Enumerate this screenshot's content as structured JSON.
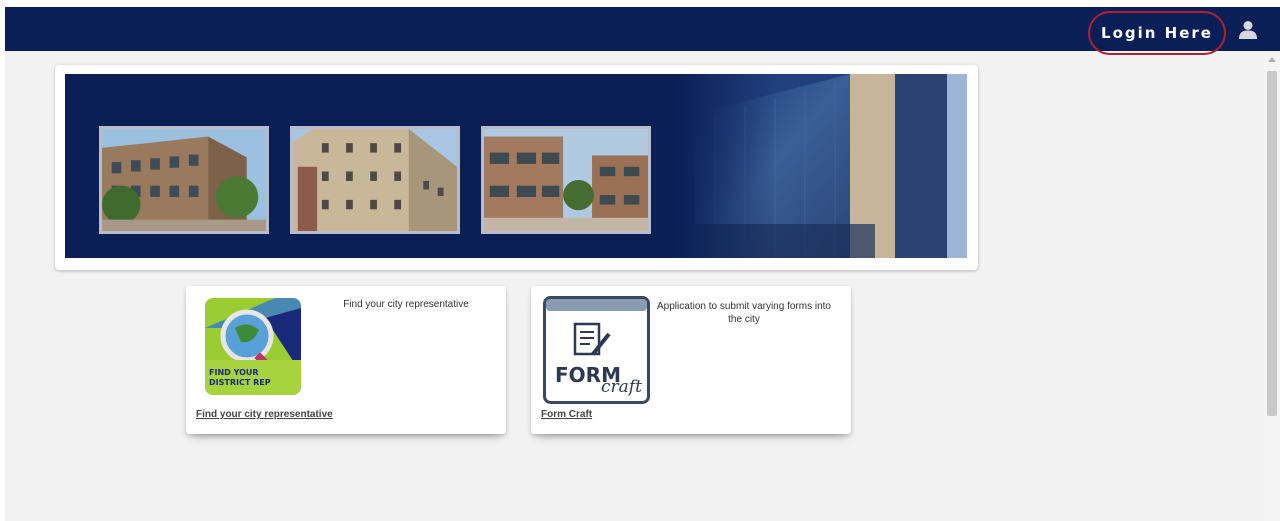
{
  "header": {
    "login_label": "Login Here",
    "user_icon": "user-icon",
    "bar_color": "#0b1f57",
    "highlight_color": "#b02030"
  },
  "banner": {
    "photos": [
      "building-photo-1",
      "building-photo-2",
      "building-photo-3"
    ],
    "background_color": "#0b1f57"
  },
  "apps": [
    {
      "description": "Find your city representative",
      "link_label": "Find your city representative",
      "logo_text_line1": "FIND YOUR",
      "logo_text_line2": "DISTRICT REP"
    },
    {
      "description": "Application to submit varying forms into the city",
      "link_label": "Form Craft",
      "logo_text_main": "FORM",
      "logo_text_script": "craft"
    }
  ]
}
